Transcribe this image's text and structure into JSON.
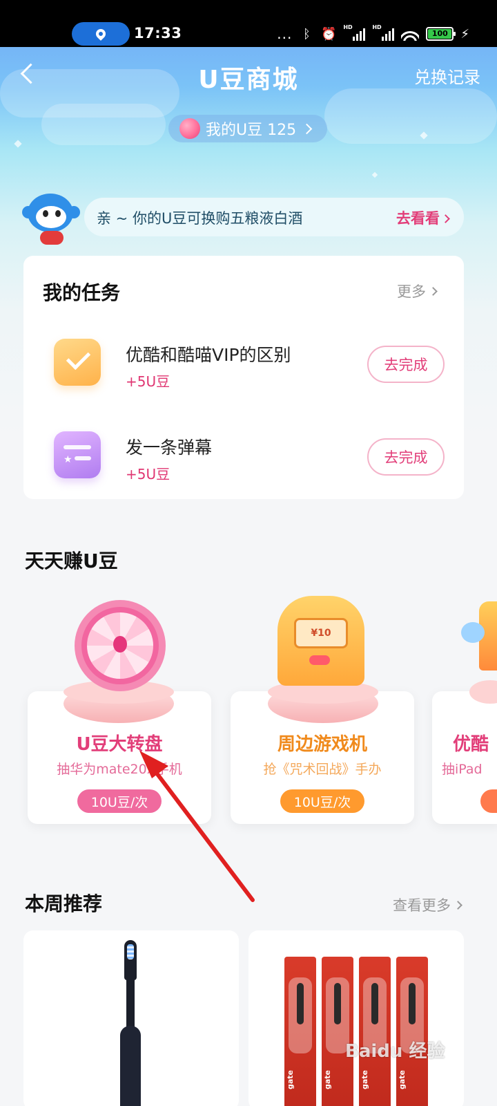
{
  "status_bar": {
    "time": "17:33",
    "dots": "...",
    "signal_tag": "HD",
    "battery": "100"
  },
  "header": {
    "title": "U豆商城",
    "exchange_link": "兑换记录"
  },
  "beans": {
    "label": "我的U豆 125"
  },
  "promo": {
    "text": "亲 ~ 你的U豆可换购五粮液白酒",
    "link": "去看看"
  },
  "tasks": {
    "title": "我的任务",
    "more": "更多",
    "items": [
      {
        "name": "优酷和酷喵VIP的区别",
        "reward": "+5U豆",
        "button": "去完成",
        "icon": "checkbox-icon"
      },
      {
        "name": "发一条弹幕",
        "reward": "+5U豆",
        "button": "去完成",
        "icon": "danmu-icon"
      }
    ]
  },
  "earn": {
    "title": "天天赚U豆",
    "items": [
      {
        "name": "U豆大转盘",
        "desc": "抽华为mate20X手机",
        "price": "10U豆/次",
        "color": "#e23e79",
        "desc_color": "#e46a98",
        "price_bg": "#f06a9e"
      },
      {
        "name": "周边游戏机",
        "desc": "抢《咒术回战》手办",
        "price": "10U豆/次",
        "color": "#f08a1c",
        "desc_color": "#f4a85a",
        "price_bg": "#ff9a2e"
      },
      {
        "name": "优酷",
        "desc": "抽iPad"
      }
    ],
    "arcade_screen": "¥10"
  },
  "weekly": {
    "title": "本周推荐",
    "more": "查看更多",
    "pack_label": "gate"
  },
  "watermark": "Baidu 经验",
  "colors": {
    "accent": "#e23e79",
    "annotation_arrow": "#e02020"
  }
}
